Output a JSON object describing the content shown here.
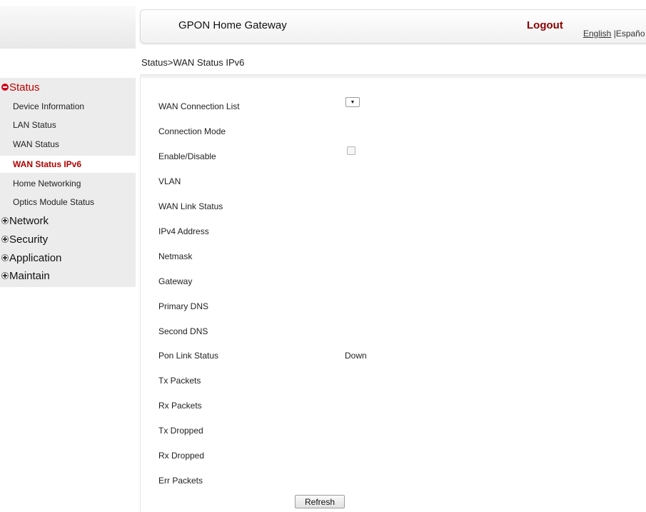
{
  "header": {
    "title": "GPON Home Gateway",
    "logout": "Logout",
    "lang_english": "English",
    "lang_separator": " |",
    "lang_espanol": "Españo"
  },
  "breadcrumb": "Status>WAN Status IPv6",
  "sidebar": {
    "groups": [
      {
        "label": "Status",
        "state": "expanded"
      },
      {
        "label": "Network",
        "state": "collapsed"
      },
      {
        "label": "Security",
        "state": "collapsed"
      },
      {
        "label": "Application",
        "state": "collapsed"
      },
      {
        "label": "Maintain",
        "state": "collapsed"
      }
    ],
    "status_items": [
      {
        "label": "Device Information"
      },
      {
        "label": "LAN Status"
      },
      {
        "label": "WAN Status"
      },
      {
        "label": "WAN Status IPv6",
        "active": true
      },
      {
        "label": "Home Networking"
      },
      {
        "label": "Optics Module Status"
      }
    ]
  },
  "form": {
    "rows": [
      {
        "label": "WAN Connection List",
        "value": ""
      },
      {
        "label": "Connection Mode",
        "value": ""
      },
      {
        "label": "Enable/Disable",
        "value": ""
      },
      {
        "label": "VLAN",
        "value": ""
      },
      {
        "label": "WAN Link Status",
        "value": ""
      },
      {
        "label": "IPv4 Address",
        "value": ""
      },
      {
        "label": "Netmask",
        "value": ""
      },
      {
        "label": "Gateway",
        "value": ""
      },
      {
        "label": "Primary DNS",
        "value": ""
      },
      {
        "label": "Second DNS",
        "value": ""
      },
      {
        "label": "Pon Link Status",
        "value": "Down"
      },
      {
        "label": "Tx Packets",
        "value": ""
      },
      {
        "label": "Rx Packets",
        "value": ""
      },
      {
        "label": "Tx Dropped",
        "value": ""
      },
      {
        "label": "Rx Dropped",
        "value": ""
      },
      {
        "label": "Err Packets",
        "value": ""
      }
    ],
    "wan_connection_select": "▼",
    "enable_checked": false,
    "refresh_label": "Refresh"
  },
  "colors": {
    "accent": "#b10000",
    "logout": "#8b0000",
    "sidebar_bg": "#ececec"
  }
}
